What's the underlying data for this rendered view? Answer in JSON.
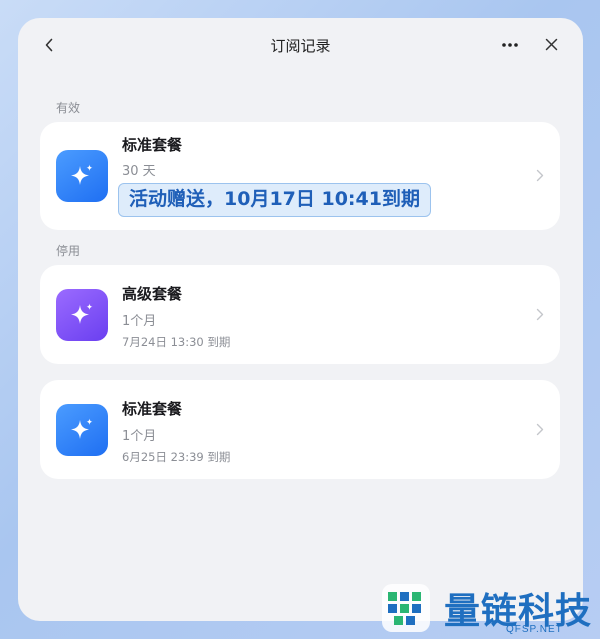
{
  "titlebar": {
    "title": "订阅记录",
    "back_icon": "chevron-left-icon",
    "more_icon": "more-horizontal-icon",
    "close_icon": "close-icon"
  },
  "sections": {
    "active_label": "有效",
    "inactive_label": "停用"
  },
  "active_plans": [
    {
      "name": "标准套餐",
      "duration": "30 天",
      "highlight": "活动赠送，10月17日 10:41到期",
      "icon": "sparkle-icon",
      "color": "#2f7df6"
    }
  ],
  "inactive_plans": [
    {
      "name": "高级套餐",
      "duration": "1个月",
      "expiry": "7月24日 13:30 到期",
      "icon": "sparkle-icon",
      "color": "#7a4ef5"
    },
    {
      "name": "标准套餐",
      "duration": "1个月",
      "expiry": "6月25日 23:39 到期",
      "icon": "sparkle-icon",
      "color": "#2f7df6"
    }
  ],
  "watermark": {
    "text": "量链科技",
    "subtext": "QFSP.NET"
  }
}
